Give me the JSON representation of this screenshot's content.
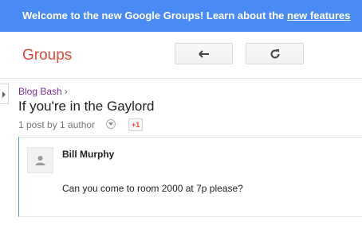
{
  "banner": {
    "message": "Welcome to the new Google Groups! Learn about the ",
    "link_text": "new features"
  },
  "header": {
    "app_title": "Groups",
    "back_icon": "arrow-left-icon",
    "refresh_icon": "refresh-icon"
  },
  "sidebar": {
    "toggle_icon": "chevron-right-icon"
  },
  "topic": {
    "breadcrumb_group": "Blog Bash",
    "breadcrumb_sep": "›",
    "title": "If you're in the Gaylord",
    "meta": "1 post by 1 author",
    "gplus_label": "+1"
  },
  "post": {
    "author": "Bill Murphy",
    "body": "Can you come to room 2000 at 7p please?",
    "avatar_icon": "person-icon"
  },
  "colors": {
    "banner_bg": "#4a8af4",
    "app_title": "#dd4b39",
    "breadcrumb": "#7a2d9a",
    "post_accent": "#4d90fe"
  }
}
